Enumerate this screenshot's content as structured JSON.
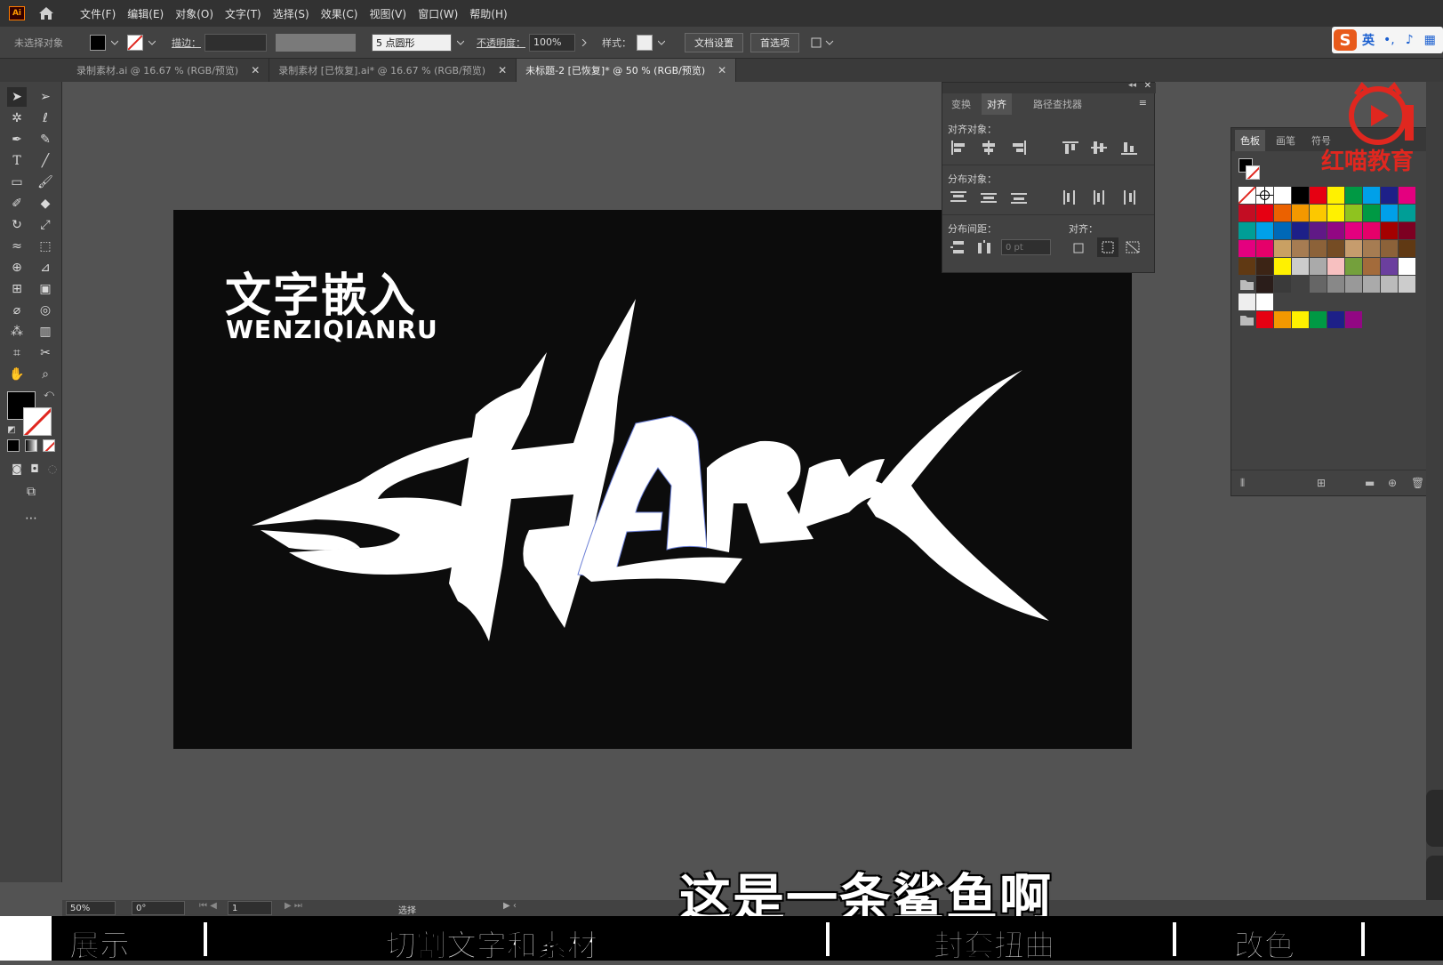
{
  "app": {
    "logo_text": "Ai"
  },
  "menu": [
    "文件(F)",
    "编辑(E)",
    "对象(O)",
    "文字(T)",
    "选择(S)",
    "效果(C)",
    "视图(V)",
    "窗口(W)",
    "帮助(H)"
  ],
  "control_bar": {
    "selection_status": "未选择对象",
    "stroke_label": "描边：",
    "brush_value": "5 点圆形",
    "opacity_label": "不透明度：",
    "opacity_value": "100%",
    "style_label": "样式：",
    "doc_setup_button": "文档设置",
    "preferences_button": "首选项"
  },
  "ime": {
    "mode": "英"
  },
  "tabs": [
    {
      "label": "录制素材.ai @ 16.67 % (RGB/预览)",
      "active": false
    },
    {
      "label": "录制素材 [已恢复].ai* @ 16.67 % (RGB/预览)",
      "active": false
    },
    {
      "label": "未标题-2 [已恢复]* @ 50 % (RGB/预览)",
      "active": true
    }
  ],
  "artboard": {
    "title_cn": "文字嵌入",
    "title_en": "WENZIQIANRU",
    "bg_color": "#0c0c0c"
  },
  "align_panel": {
    "tabs": [
      "变换",
      "对齐",
      "路径查找器"
    ],
    "active_tab": "对齐",
    "align_objects_label": "对齐对象：",
    "distribute_objects_label": "分布对象：",
    "distribute_spacing_label": "分布间距：",
    "align_to_label": "对齐：",
    "spacing_value": "0 pt"
  },
  "swatch_panel": {
    "tabs": [
      "色板",
      "画笔",
      "符号"
    ],
    "active_tab": "色板"
  },
  "watermark": {
    "text": "红喵教育"
  },
  "statusbar": {
    "zoom": "50%",
    "rotation": "0°",
    "artboard_num": "1",
    "tool": "选择"
  },
  "caption": "这是一条鲨鱼啊",
  "chapters": [
    "展示",
    "切割文字和素材",
    "封套扭曲",
    "改色"
  ],
  "colors": {
    "accent_red": "#e0271f",
    "ui_dark": "#323232",
    "ui_mid": "#424242",
    "canvas": "#535353"
  }
}
